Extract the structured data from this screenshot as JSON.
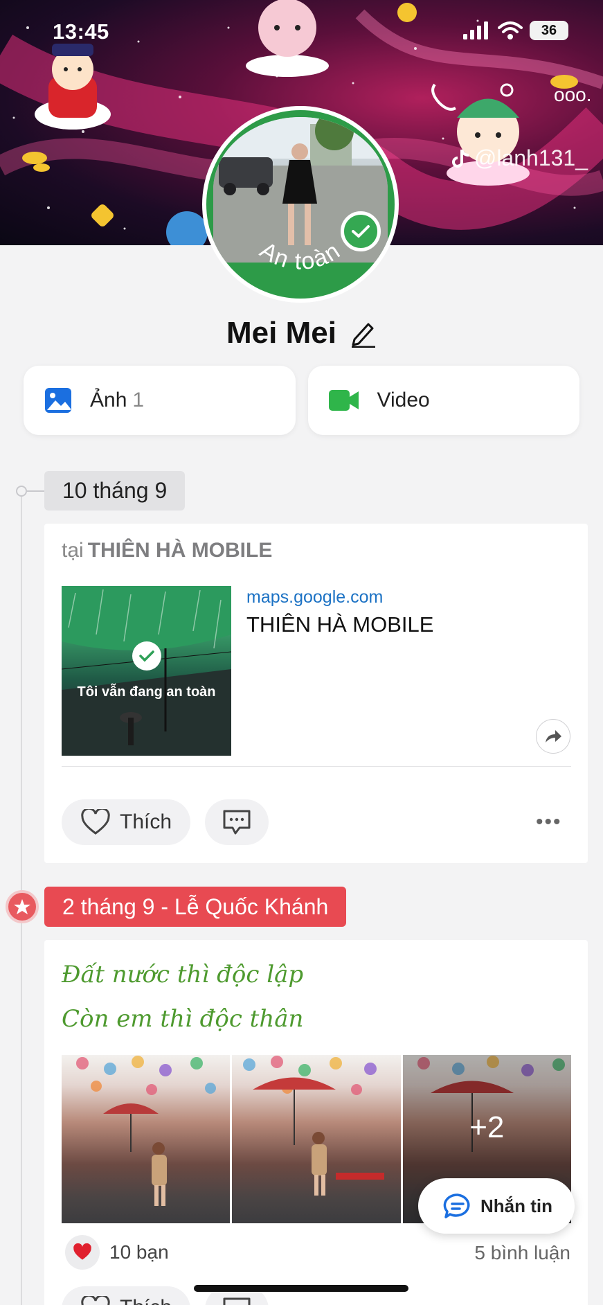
{
  "status_bar": {
    "time": "13:45",
    "battery": "36"
  },
  "cover": {
    "tiktok_handle": "@lanh131_"
  },
  "profile": {
    "name": "Mei Mei",
    "avatar_badge": "An toàn"
  },
  "media": {
    "photos_label": "Ảnh",
    "photos_count": "1",
    "video_label": "Video"
  },
  "timeline": {
    "date_1": "10 tháng 9",
    "post_1": {
      "at_prefix": "tại",
      "place": "THIÊN HÀ MOBILE",
      "thumb_caption": "Tôi vẫn đang an toàn",
      "link_domain": "maps.google.com",
      "link_title": "THIÊN HÀ MOBILE",
      "like_label": "Thích"
    },
    "date_2": "2 tháng 9 - Lễ Quốc Khánh",
    "post_2": {
      "line_1": "Đất nước thì độc lập",
      "line_2": "Còn em thì độc thân",
      "more_photos": "+2",
      "reactions": "10 bạn",
      "comments": "5 bình luận",
      "like_label": "Thích"
    }
  },
  "message_button": {
    "label": "Nhắn tin"
  },
  "colors": {
    "accent_green": "#35a852",
    "holiday_red": "#e84a52",
    "link_blue": "#1c72c4",
    "quote_green": "#4e9a2f"
  }
}
